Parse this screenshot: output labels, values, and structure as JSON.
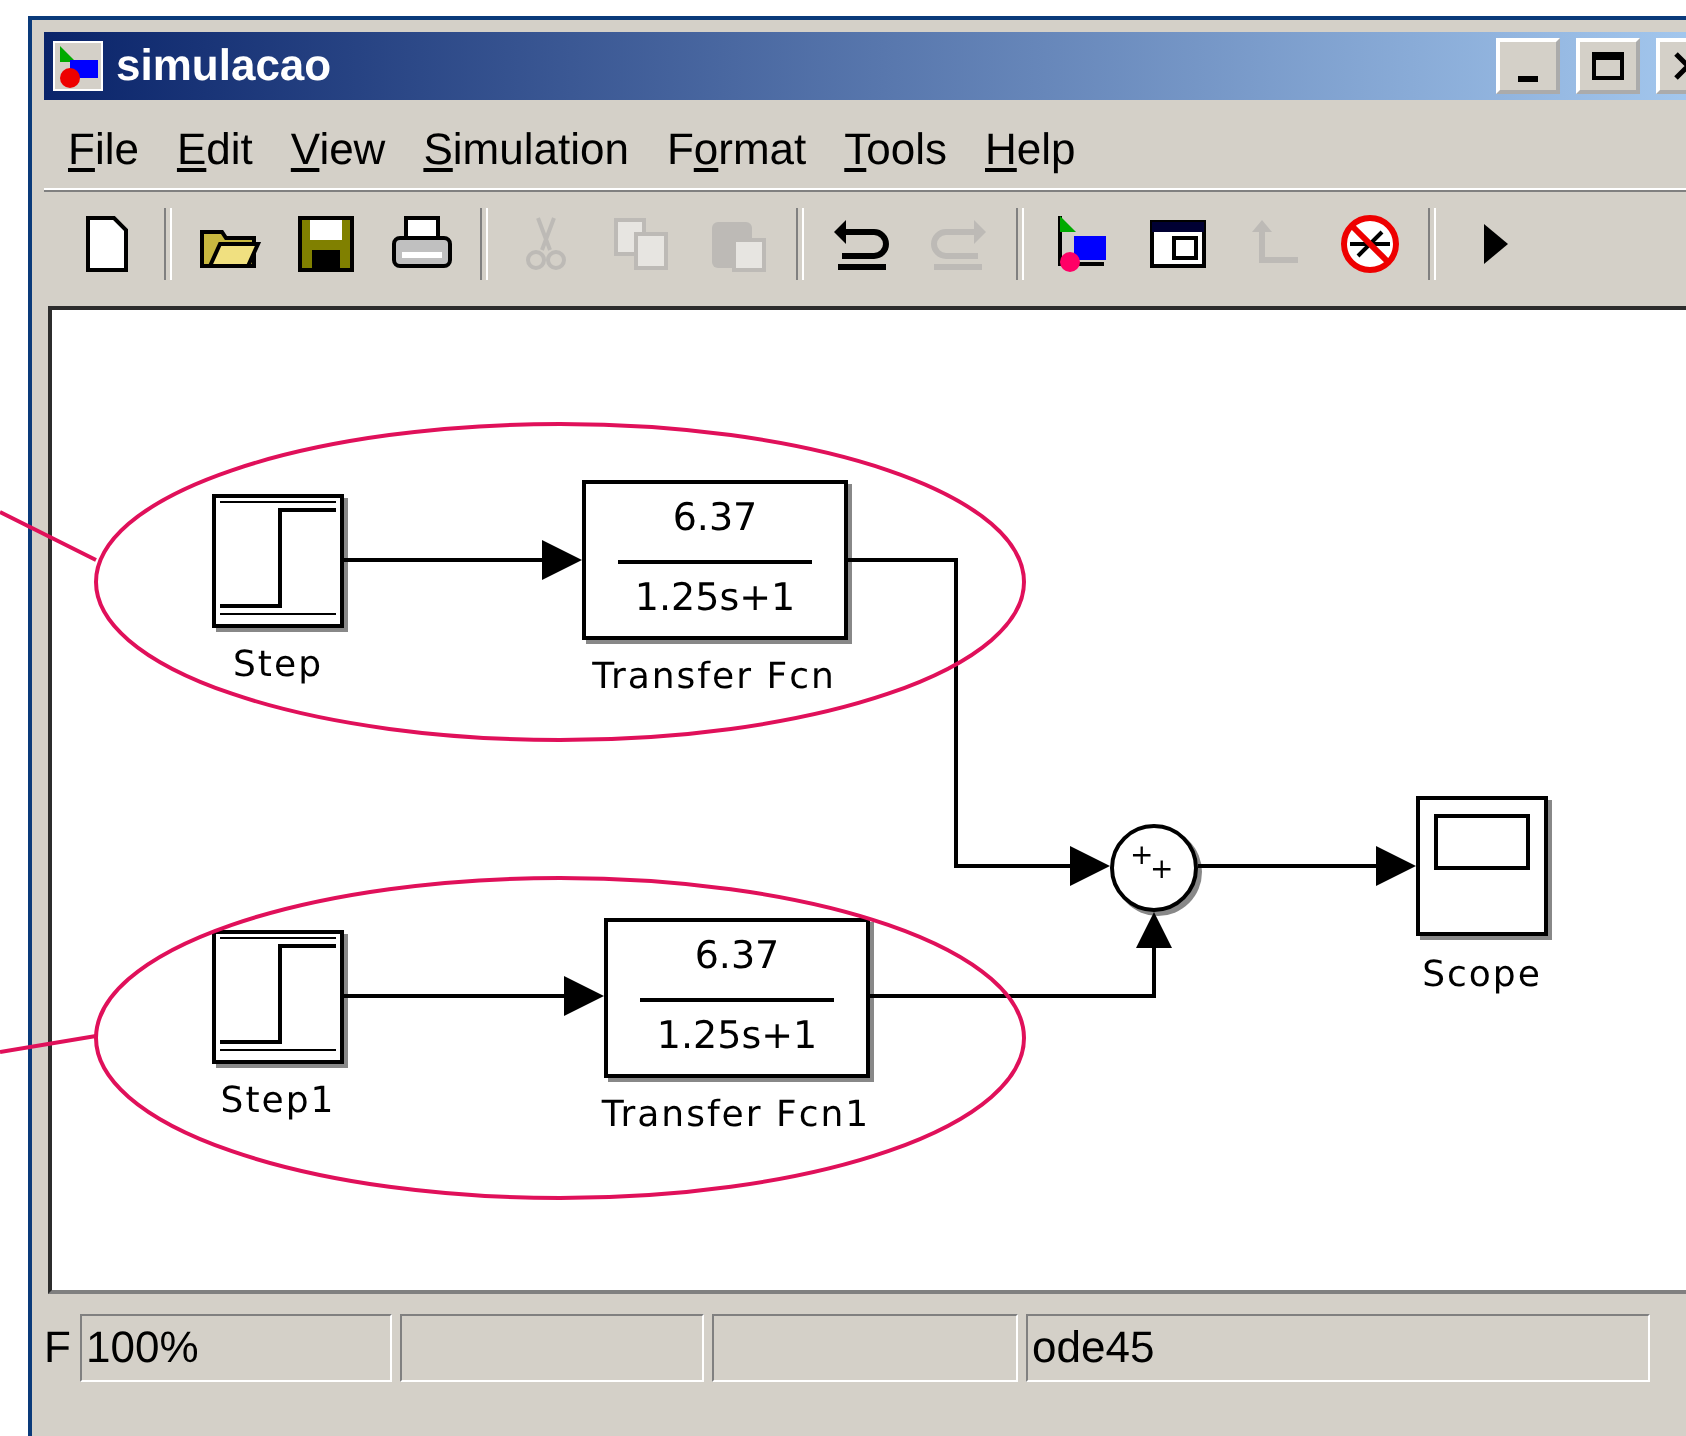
{
  "window": {
    "title": "simulacao"
  },
  "menu": [
    {
      "label": "File"
    },
    {
      "label": "Edit"
    },
    {
      "label": "View"
    },
    {
      "label": "Simulation"
    },
    {
      "label": "Format"
    },
    {
      "label": "Tools"
    },
    {
      "label": "Help"
    }
  ],
  "toolbar": [
    {
      "kind": "new",
      "disabled": false
    },
    {
      "kind": "separator"
    },
    {
      "kind": "open",
      "disabled": false
    },
    {
      "kind": "save",
      "disabled": false
    },
    {
      "kind": "print",
      "disabled": false
    },
    {
      "kind": "separator"
    },
    {
      "kind": "cut",
      "disabled": true
    },
    {
      "kind": "copy",
      "disabled": true
    },
    {
      "kind": "paste",
      "disabled": true
    },
    {
      "kind": "separator"
    },
    {
      "kind": "undo",
      "disabled": false
    },
    {
      "kind": "redo",
      "disabled": true
    },
    {
      "kind": "separator"
    },
    {
      "kind": "library",
      "disabled": false
    },
    {
      "kind": "explorer",
      "disabled": false
    },
    {
      "kind": "branch",
      "disabled": true
    },
    {
      "kind": "debug",
      "disabled": false
    },
    {
      "kind": "separator"
    },
    {
      "kind": "run",
      "disabled": false
    }
  ],
  "diagram": {
    "blocks": [
      {
        "kind": "step",
        "label": "Step"
      },
      {
        "kind": "transfer_fcn",
        "label": "Transfer Fcn",
        "numerator": "6.37",
        "denominator": "1.25s+1"
      },
      {
        "kind": "step",
        "label": "Step1"
      },
      {
        "kind": "transfer_fcn",
        "label": "Transfer Fcn1",
        "numerator": "6.37",
        "denominator": "1.25s+1"
      },
      {
        "kind": "sum",
        "signs": [
          "+",
          "+"
        ]
      },
      {
        "kind": "scope",
        "label": "Scope"
      }
    ]
  },
  "status_bar": {
    "cut_label": "F",
    "zoom": "100%",
    "solver": "ode45"
  }
}
